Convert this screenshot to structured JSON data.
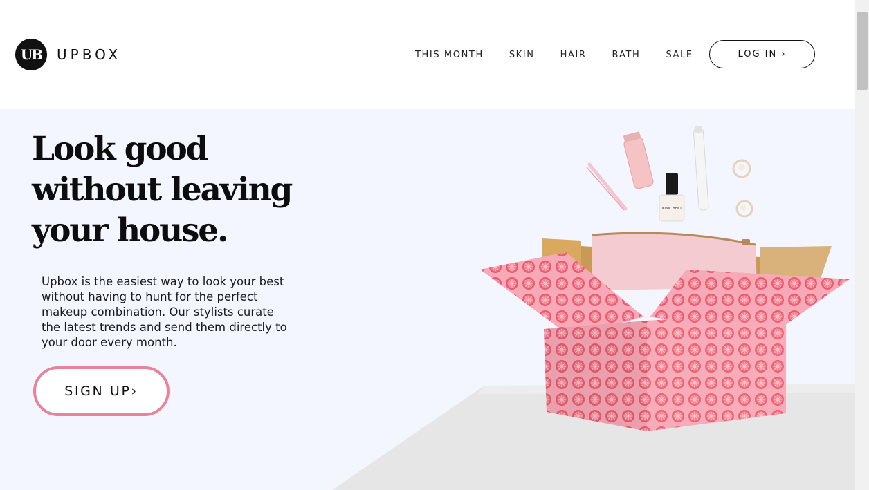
{
  "brand": {
    "badge": "UB",
    "name": "UPBOX"
  },
  "nav": {
    "items": [
      {
        "label": "THIS MONTH"
      },
      {
        "label": "SKIN"
      },
      {
        "label": "HAIR"
      },
      {
        "label": "BATH"
      },
      {
        "label": "SALE"
      }
    ],
    "login_label": "LOG IN ›"
  },
  "hero": {
    "headline_lines": [
      "Look good",
      "without leaving",
      "your house."
    ],
    "body": "Upbox is the easiest way to look your best without having to hunt for the perfect makeup combination. Our stylists curate the latest trends and send them directly to your door every month.",
    "cta_label": "SIGN UP›",
    "nail_polish_label": "IONIC BENT"
  },
  "colors": {
    "hero_bg": "#f3f6fe",
    "accent_pink": "#e8839b",
    "box_pink": "#f6a9b6",
    "slice_red": "#ec5a6e"
  }
}
